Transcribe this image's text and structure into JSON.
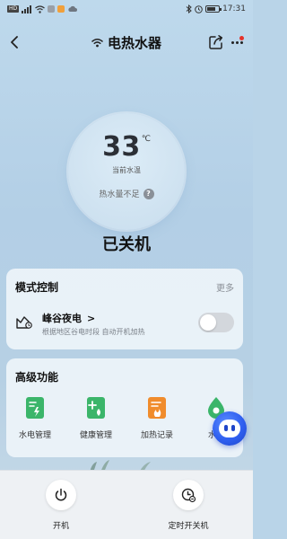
{
  "status_bar": {
    "left_badge": "HD",
    "signal_text": "⁴ᴳ",
    "time": "17:31"
  },
  "header": {
    "title": "电热水器"
  },
  "temperature": {
    "value": "33",
    "unit": "℃",
    "label": "当前水温",
    "hot_water_status": "热水量不足",
    "help_glyph": "?"
  },
  "power_status": "已关机",
  "mode_control": {
    "title": "模式控制",
    "more_label": "更多",
    "mode": {
      "name": "峰谷夜电",
      "chevron": ">",
      "description": "根据地区谷电时段 自动开机加热",
      "enabled": false
    }
  },
  "advanced": {
    "title": "高级功能",
    "items": [
      {
        "label": "水电管理",
        "icon": "water-electric-icon",
        "color": "#3bb56a"
      },
      {
        "label": "健康管理",
        "icon": "health-icon",
        "color": "#3bb56a"
      },
      {
        "label": "加热记录",
        "icon": "heating-record-icon",
        "color": "#f08c2c"
      },
      {
        "label": "水质",
        "icon": "water-quality-icon",
        "color": "#3bb56a"
      }
    ]
  },
  "bottom_actions": {
    "power_label": "开机",
    "timer_label": "定时开关机"
  },
  "colors": {
    "accent_green": "#3bb56a",
    "accent_orange": "#f08c2c",
    "assistant_blue": "#2f5ff0",
    "notification_red": "#e5332a"
  }
}
